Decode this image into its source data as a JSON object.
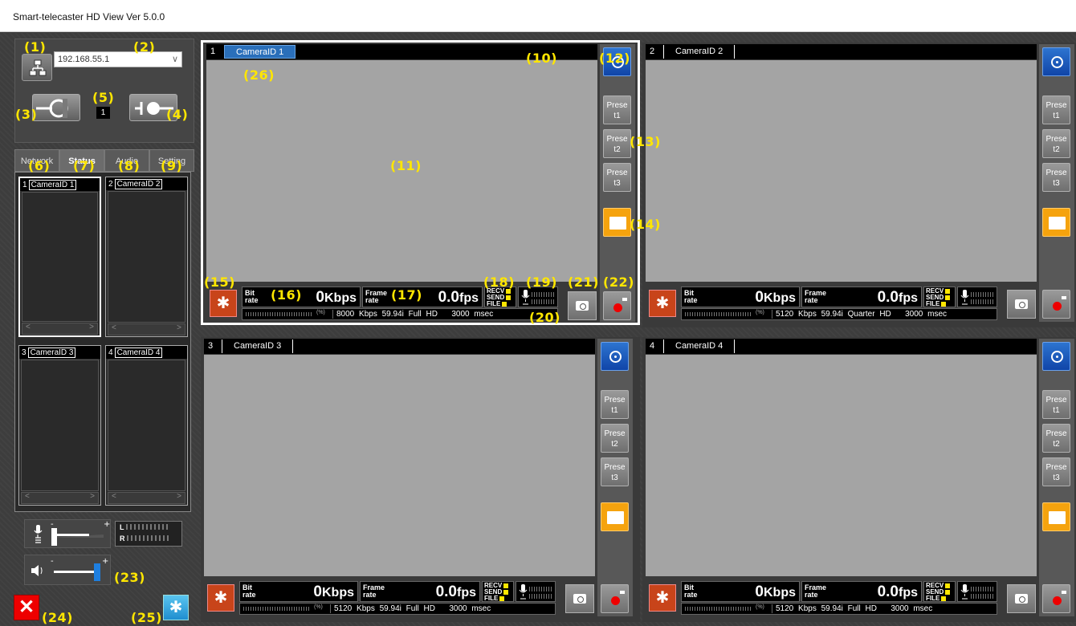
{
  "window": {
    "title": "Smart-telecaster HD View Ver 5.0.0"
  },
  "connection": {
    "ip_address": "192.168.55.1",
    "selected_number": "1"
  },
  "tabs": [
    {
      "label": "Network"
    },
    {
      "label": "Status"
    },
    {
      "label": "Audio"
    },
    {
      "label": "Setting"
    }
  ],
  "status_list": [
    {
      "num": "1",
      "camera_id": "CameraID 1"
    },
    {
      "num": "2",
      "camera_id": "CameraID 2"
    },
    {
      "num": "3",
      "camera_id": "CameraID 3"
    },
    {
      "num": "4",
      "camera_id": "CameraID 4"
    }
  ],
  "audio_meter": {
    "left_label": "L",
    "right_label": "R"
  },
  "cameras": [
    {
      "num": "1",
      "camera_id": "CameraID 1",
      "bitrate": "0",
      "bitrate_unit": "Kbps",
      "framerate": "0.0",
      "framerate_unit": "fps",
      "info_bitrate": "8000 Kbps",
      "info_rate": "59.94i",
      "info_resolution": "Full HD",
      "info_latency": "3000 msec"
    },
    {
      "num": "2",
      "camera_id": "CameraID 2",
      "bitrate": "0",
      "bitrate_unit": "Kbps",
      "framerate": "0.0",
      "framerate_unit": "fps",
      "info_bitrate": "5120 Kbps",
      "info_rate": "59.94i",
      "info_resolution": "Quarter HD",
      "info_latency": "3000 msec"
    },
    {
      "num": "3",
      "camera_id": "CameraID 3",
      "bitrate": "0",
      "bitrate_unit": "Kbps",
      "framerate": "0.0",
      "framerate_unit": "fps",
      "info_bitrate": "5120 Kbps",
      "info_rate": "59.94i",
      "info_resolution": "Full HD",
      "info_latency": "3000 msec"
    },
    {
      "num": "4",
      "camera_id": "CameraID 4",
      "bitrate": "0",
      "bitrate_unit": "Kbps",
      "framerate": "0.0",
      "framerate_unit": "fps",
      "info_bitrate": "5120 Kbps",
      "info_rate": "59.94i",
      "info_resolution": "Full HD",
      "info_latency": "3000 msec"
    }
  ],
  "labels": {
    "bit": "Bit",
    "rate": "rate",
    "frame": "Frame",
    "recv": "RECV",
    "send": "SEND",
    "file": "FILE",
    "preset1_a": "Prese",
    "preset1_b": "t1",
    "preset2_a": "Prese",
    "preset2_b": "t2",
    "preset3_a": "Prese",
    "preset3_b": "t3",
    "pct_top": "100",
    "pct_bottom": "(%)"
  },
  "annotations": [
    "(1)",
    "(2)",
    "(3)",
    "(4)",
    "(5)",
    "(6)",
    "(7)",
    "(8)",
    "(9)",
    "(10)",
    "(11)",
    "(12)",
    "(13)",
    "(14)",
    "(15)",
    "(16)",
    "(17)",
    "(18)",
    "(19)",
    "(20)",
    "(21)",
    "(22)",
    "(23)",
    "(24)",
    "(25)",
    "(26)"
  ],
  "colors": {
    "accent_blue": "#1045a8",
    "record_red": "#e00000",
    "folder_orange": "#f5a30e",
    "settings_orange": "#c8441a",
    "annotation_yellow": "#ffe600"
  }
}
